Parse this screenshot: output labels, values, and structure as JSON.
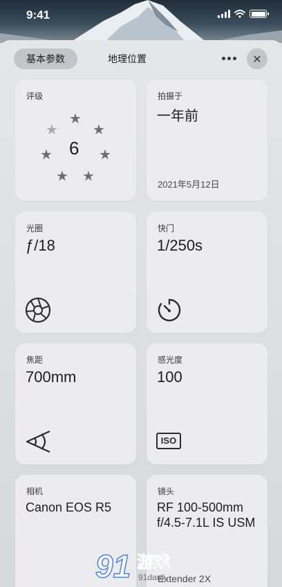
{
  "status_bar": {
    "time": "9:41"
  },
  "tabs": [
    {
      "label": "基本参数",
      "active": true
    },
    {
      "label": "地理位置",
      "active": false
    }
  ],
  "header_actions": {
    "more_icon": "ellipsis-icon",
    "close_icon": "close-icon",
    "close_glyph": "✕"
  },
  "cards": {
    "rating": {
      "label": "评级",
      "value": "6",
      "stars_total": 7,
      "stars_dimmed": 1
    },
    "taken": {
      "label": "拍摄于",
      "value": "一年前",
      "date": "2021年5月12日"
    },
    "aperture": {
      "label": "光圈",
      "value": "ƒ/18",
      "icon": "aperture-icon"
    },
    "shutter": {
      "label": "快门",
      "value": "1/250s",
      "icon": "timer-icon"
    },
    "focal": {
      "label": "焦距",
      "value": "700mm",
      "icon": "field-of-view-icon"
    },
    "iso": {
      "label": "感光度",
      "value": "100",
      "icon": "iso-icon",
      "icon_text": "ISO"
    },
    "camera": {
      "label": "相机",
      "value": "Canon EOS R5"
    },
    "lens": {
      "label": "镜头",
      "value": "RF 100-500mm f/4.5-7.1L IS USM",
      "extra": "Extender 2X"
    }
  },
  "watermark": {
    "brand": "91",
    "text": "游戏",
    "site": "91danji"
  },
  "colors": {
    "accent": "#3478f6",
    "card": "#ececee",
    "pill_active": "#c2c5c9"
  }
}
